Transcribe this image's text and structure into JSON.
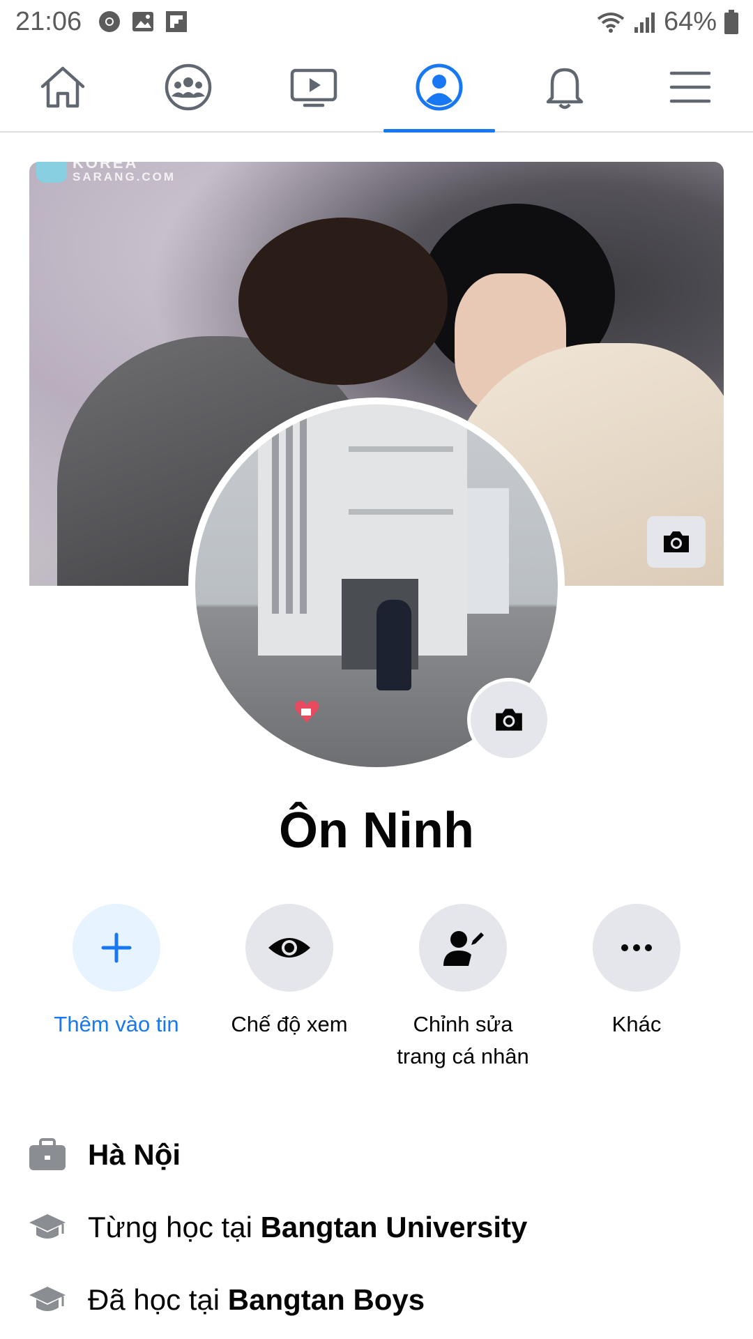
{
  "status_bar": {
    "time": "21:06",
    "battery_pct": "64%",
    "left_icons": [
      "chrome-icon",
      "gallery-icon",
      "flipboard-icon"
    ],
    "right_icons": [
      "wifi-icon",
      "signal-icon",
      "battery-icon"
    ]
  },
  "nav": {
    "tabs": [
      {
        "name": "home",
        "icon": "home-icon",
        "active": false
      },
      {
        "name": "groups",
        "icon": "groups-icon",
        "active": false
      },
      {
        "name": "watch",
        "icon": "video-icon",
        "active": false
      },
      {
        "name": "profile",
        "icon": "profile-icon",
        "active": true
      },
      {
        "name": "notifications",
        "icon": "bell-icon",
        "active": false
      },
      {
        "name": "menu",
        "icon": "hamburger-icon",
        "active": false
      }
    ],
    "accent_color": "#1877f2"
  },
  "cover": {
    "watermark_top": "KOREA",
    "watermark_bottom": "SARANG.COM"
  },
  "profile": {
    "name": "Ôn Ninh"
  },
  "actions": [
    {
      "label": "Thêm vào tin",
      "icon": "plus-icon"
    },
    {
      "label": "Chế độ xem",
      "icon": "eye-icon"
    },
    {
      "label": "Chỉnh sửa trang cá nhân",
      "icon": "edit-profile-icon"
    },
    {
      "label": "Khác",
      "icon": "more-icon"
    }
  ],
  "about": {
    "work_location": "Hà Nội",
    "studied_prefix": "Từng học tại",
    "studied_school": "Bangtan University",
    "went_prefix": "Đã học tại",
    "went_school": "Bangtan Boys"
  }
}
